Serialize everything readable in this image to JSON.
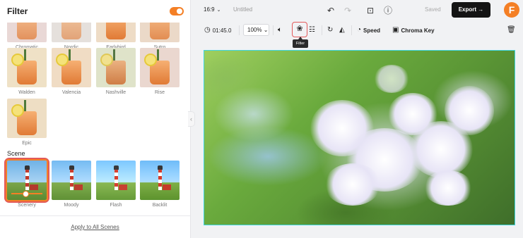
{
  "panel": {
    "title": "Filter",
    "toggle_on": true,
    "filters": [
      {
        "label": "Chromatic"
      },
      {
        "label": "Nordic"
      },
      {
        "label": "Earlybird"
      },
      {
        "label": "Sutro"
      },
      {
        "label": "Walden"
      },
      {
        "label": "Valencia"
      },
      {
        "label": "Nashville"
      },
      {
        "label": "Rise"
      },
      {
        "label": "Epic"
      }
    ],
    "scene_title": "Scene",
    "scenes": [
      {
        "label": "Scenery",
        "selected": true
      },
      {
        "label": "Moody"
      },
      {
        "label": "Flash"
      },
      {
        "label": "Backlit"
      }
    ],
    "apply_all": "Apply to All Scenes"
  },
  "topbar": {
    "ratio": "16:9",
    "title": "Untitled",
    "saved": "Saved",
    "export": "Export"
  },
  "logo_letter": "F",
  "toolbar": {
    "duration": "01:45.0",
    "zoom": "100%",
    "speed": "Speed",
    "chroma": "Chroma Key",
    "tooltip": "Filter"
  },
  "colors": {
    "accent": "#f47f25",
    "highlight": "#e25a5a",
    "canvas_border": "#3ed6e0"
  }
}
